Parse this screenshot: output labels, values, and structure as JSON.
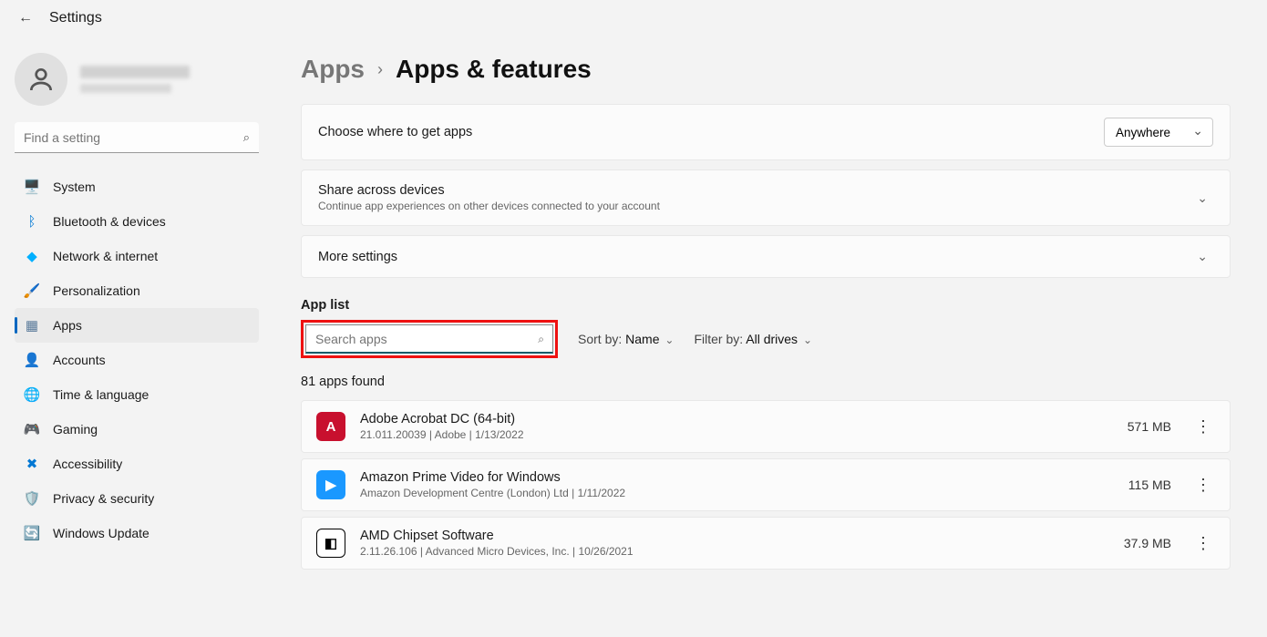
{
  "window": {
    "title": "Settings"
  },
  "sidebar": {
    "search_placeholder": "Find a setting",
    "items": [
      {
        "label": "System",
        "icon": "🖥️",
        "color": "#0078d4"
      },
      {
        "label": "Bluetooth & devices",
        "icon": "ᛒ",
        "color": "#0078d4"
      },
      {
        "label": "Network & internet",
        "icon": "◆",
        "color": "#00b0ff"
      },
      {
        "label": "Personalization",
        "icon": "🖌️",
        "color": "#d06a2a"
      },
      {
        "label": "Apps",
        "icon": "▦",
        "color": "#5a7a9a"
      },
      {
        "label": "Accounts",
        "icon": "👤",
        "color": "#2e9a5a"
      },
      {
        "label": "Time & language",
        "icon": "🌐",
        "color": "#3a74c4"
      },
      {
        "label": "Gaming",
        "icon": "🎮",
        "color": "#888"
      },
      {
        "label": "Accessibility",
        "icon": "✖",
        "color": "#0078d4"
      },
      {
        "label": "Privacy & security",
        "icon": "🛡️",
        "color": "#888"
      },
      {
        "label": "Windows Update",
        "icon": "🔄",
        "color": "#0078d4"
      }
    ]
  },
  "breadcrumb": {
    "parent": "Apps",
    "current": "Apps & features"
  },
  "cards": {
    "choose_where": {
      "title": "Choose where to get apps",
      "value": "Anywhere"
    },
    "share_across": {
      "title": "Share across devices",
      "sub": "Continue app experiences on other devices connected to your account"
    },
    "more_settings": {
      "title": "More settings"
    }
  },
  "app_list": {
    "heading": "App list",
    "search_placeholder": "Search apps",
    "sort_label": "Sort by:",
    "sort_value": "Name",
    "filter_label": "Filter by:",
    "filter_value": "All drives",
    "found": "81 apps found",
    "apps": [
      {
        "name": "Adobe Acrobat DC (64-bit)",
        "meta": "21.011.20039  |  Adobe  |  1/13/2022",
        "size": "571 MB",
        "icon_bg": "#c8102e",
        "icon_txt": "A"
      },
      {
        "name": "Amazon Prime Video for Windows",
        "meta": "Amazon Development Centre (London) Ltd  |  1/11/2022",
        "size": "115 MB",
        "icon_bg": "#1a98ff",
        "icon_txt": "▶"
      },
      {
        "name": "AMD Chipset Software",
        "meta": "2.11.26.106  |  Advanced Micro Devices, Inc.  |  10/26/2021",
        "size": "37.9 MB",
        "icon_bg": "#ffffff",
        "icon_txt": "◧",
        "icon_fg": "#000"
      }
    ]
  }
}
